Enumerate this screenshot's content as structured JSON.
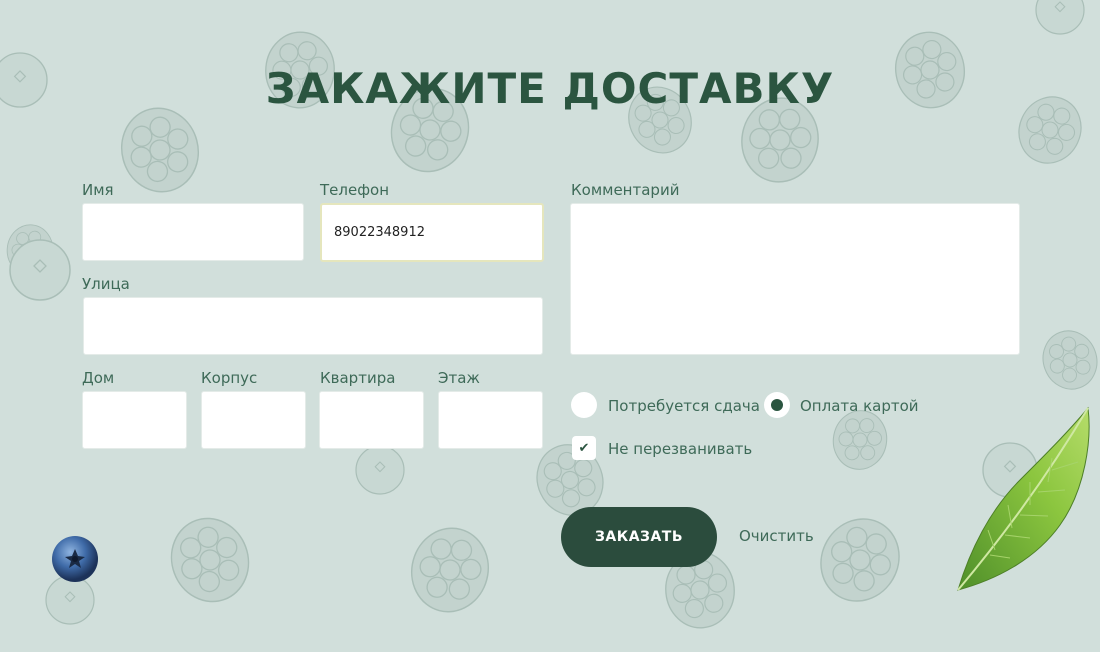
{
  "title": "ЗАКАЖИТЕ ДОСТАВКУ",
  "form": {
    "name_label": "Имя",
    "name_value": "",
    "phone_label": "Телефон",
    "phone_value": "89022348912",
    "street_label": "Улица",
    "street_value": "",
    "house_label": "Дом",
    "building_label": "Корпус",
    "apartment_label": "Квартира",
    "floor_label": "Этаж",
    "comment_label": "Комментарий",
    "comment_value": ""
  },
  "payment": {
    "change_label": "Потребуется сдача",
    "change_selected": false,
    "card_label": "Оплата картой",
    "card_selected": true
  },
  "callback": {
    "label": "Не перезванивать",
    "checked": true
  },
  "actions": {
    "submit_label": "ЗАКАЗАТЬ",
    "clear_label": "Очистить"
  },
  "colors": {
    "background": "#d1dfdb",
    "accent": "#2b4c3d",
    "text": "#3e6a58"
  },
  "icons": {
    "checkbox": "check-icon",
    "decor_left": "blueberry-icon",
    "decor_right": "leaf-icon"
  }
}
